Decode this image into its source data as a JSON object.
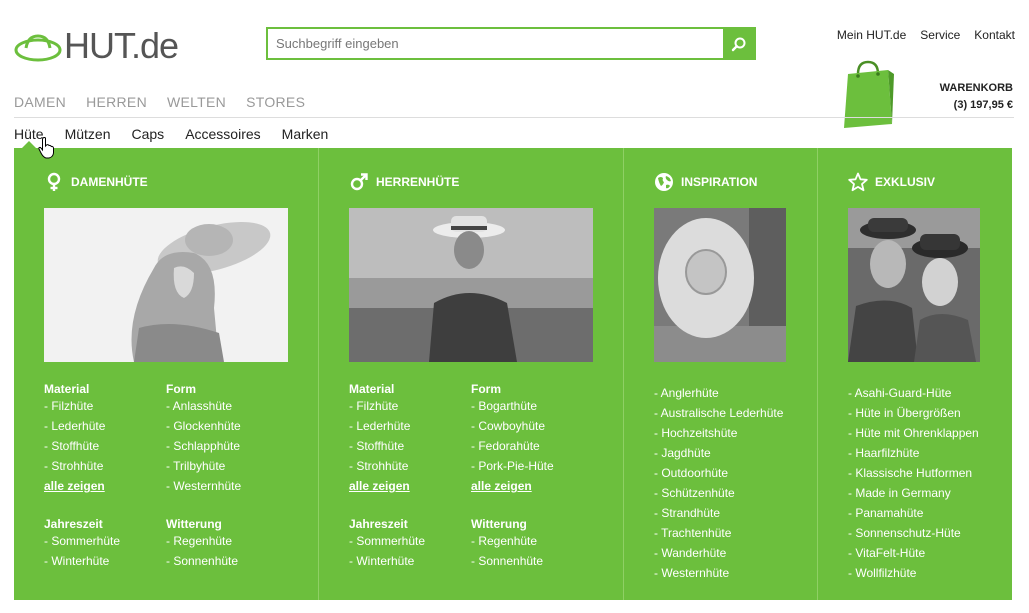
{
  "logo": {
    "text": "HUT.de"
  },
  "search": {
    "placeholder": "Suchbegriff eingeben"
  },
  "toplinks": [
    "Mein HUT.de",
    "Service",
    "Kontakt"
  ],
  "cart": {
    "label": "WARENKORB",
    "summary": "(3) 197,95 €"
  },
  "main_nav": [
    "DAMEN",
    "HERREN",
    "WELTEN",
    "STORES"
  ],
  "sub_nav": [
    "Hüte",
    "Mützen",
    "Caps",
    "Accessoires",
    "Marken"
  ],
  "colors": {
    "accent": "#6cbf3d"
  },
  "columns": [
    {
      "title": "DAMENHÜTE",
      "icon": "female-icon",
      "groups": [
        {
          "title": "Material",
          "items": [
            "- Filzhüte",
            "- Lederhüte",
            "- Stoffhüte",
            "- Strohhüte"
          ],
          "all": "alle zeigen"
        },
        {
          "title": "Form",
          "items": [
            "- Anlasshüte",
            "- Glockenhüte",
            "- Schlapphüte",
            "- Trilbyhüte",
            "- Westernhüte"
          ],
          "all": ""
        },
        {
          "title": "Jahreszeit",
          "items": [
            "- Sommerhüte",
            "- Winterhüte"
          ],
          "all": ""
        },
        {
          "title": "Witterung",
          "items": [
            "- Regenhüte",
            "- Sonnenhüte"
          ],
          "all": ""
        }
      ]
    },
    {
      "title": "HERRENHÜTE",
      "icon": "male-icon",
      "groups": [
        {
          "title": "Material",
          "items": [
            "- Filzhüte",
            "- Lederhüte",
            "- Stoffhüte",
            "- Strohhüte"
          ],
          "all": "alle zeigen"
        },
        {
          "title": "Form",
          "items": [
            "- Bogarthüte",
            "- Cowboyhüte",
            "- Fedorahüte",
            "- Pork-Pie-Hüte"
          ],
          "all": "alle zeigen"
        },
        {
          "title": "Jahreszeit",
          "items": [
            "- Sommerhüte",
            "- Winterhüte"
          ],
          "all": ""
        },
        {
          "title": "Witterung",
          "items": [
            "- Regenhüte",
            "- Sonnenhüte"
          ],
          "all": ""
        }
      ]
    },
    {
      "title": "INSPIRATION",
      "icon": "globe-icon",
      "items": [
        "- Anglerhüte",
        "- Australische Lederhüte",
        "- Hochzeitshüte",
        "- Jagdhüte",
        "- Outdoorhüte",
        "- Schützenhüte",
        "- Strandhüte",
        "- Trachtenhüte",
        "- Wanderhüte",
        "- Westernhüte"
      ]
    },
    {
      "title": "EXKLUSIV",
      "icon": "star-icon",
      "items": [
        "- Asahi-Guard-Hüte",
        "- Hüte in Übergrößen",
        "- Hüte mit Ohrenklappen",
        "- Haarfilzhüte",
        "- Klassische Hutformen",
        "- Made in Germany",
        "- Panamahüte",
        "- Sonnenschutz-Hüte",
        "- VitaFelt-Hüte",
        "- Wollfilzhüte"
      ]
    }
  ]
}
